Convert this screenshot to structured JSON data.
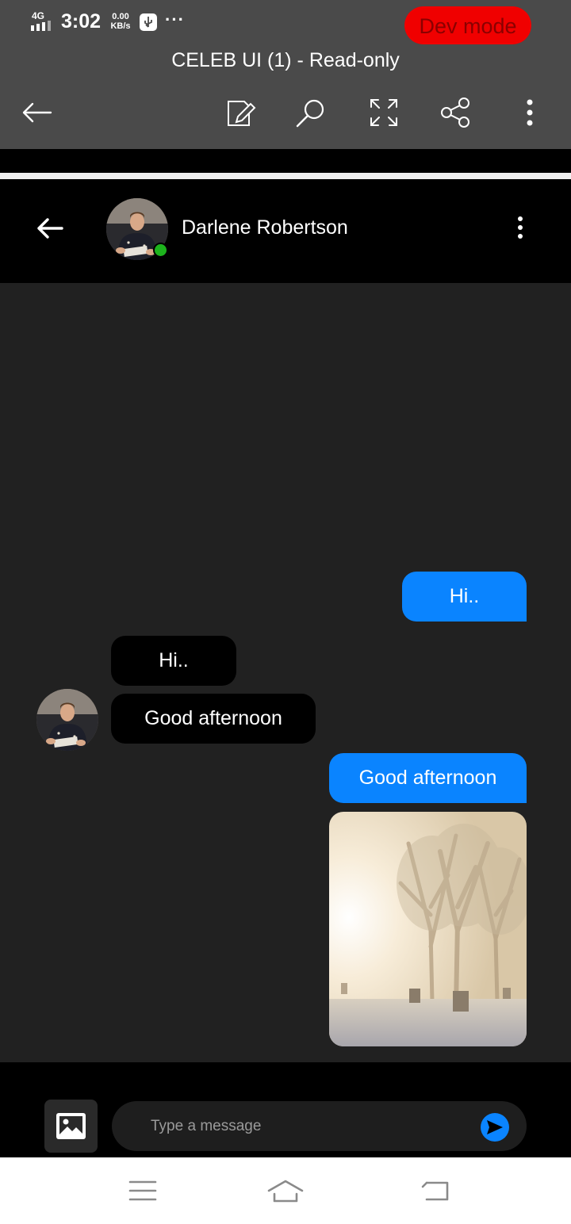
{
  "status_bar": {
    "network": "4G",
    "time": "3:02",
    "speed_value": "0.00",
    "speed_unit": "KB/s",
    "overflow": "···",
    "dev_mode": "Dev mode"
  },
  "viewer": {
    "title": "CELEB UI (1) - Read-only",
    "icons": [
      "back-arrow-icon",
      "edit-icon",
      "search-icon",
      "fullscreen-icon",
      "share-icon",
      "more-vertical-icon"
    ]
  },
  "chat": {
    "contact_name": "Darlene Robertson",
    "contact_online": true,
    "messages": [
      {
        "direction": "outgoing",
        "text": "Hi.."
      },
      {
        "direction": "incoming",
        "text": "Hi.."
      },
      {
        "direction": "incoming",
        "text": "Good afternoon"
      },
      {
        "direction": "outgoing",
        "text": "Good afternoon"
      },
      {
        "direction": "outgoing",
        "type": "image",
        "image": "foggy-trees-photo"
      }
    ]
  },
  "composer": {
    "placeholder": "Type a message",
    "value": ""
  },
  "colors": {
    "outgoing_bubble": "#0a84ff",
    "incoming_bubble": "#000000",
    "chat_background": "#212121",
    "online_indicator": "#1db31d",
    "dev_mode_pill": "#f00000"
  }
}
